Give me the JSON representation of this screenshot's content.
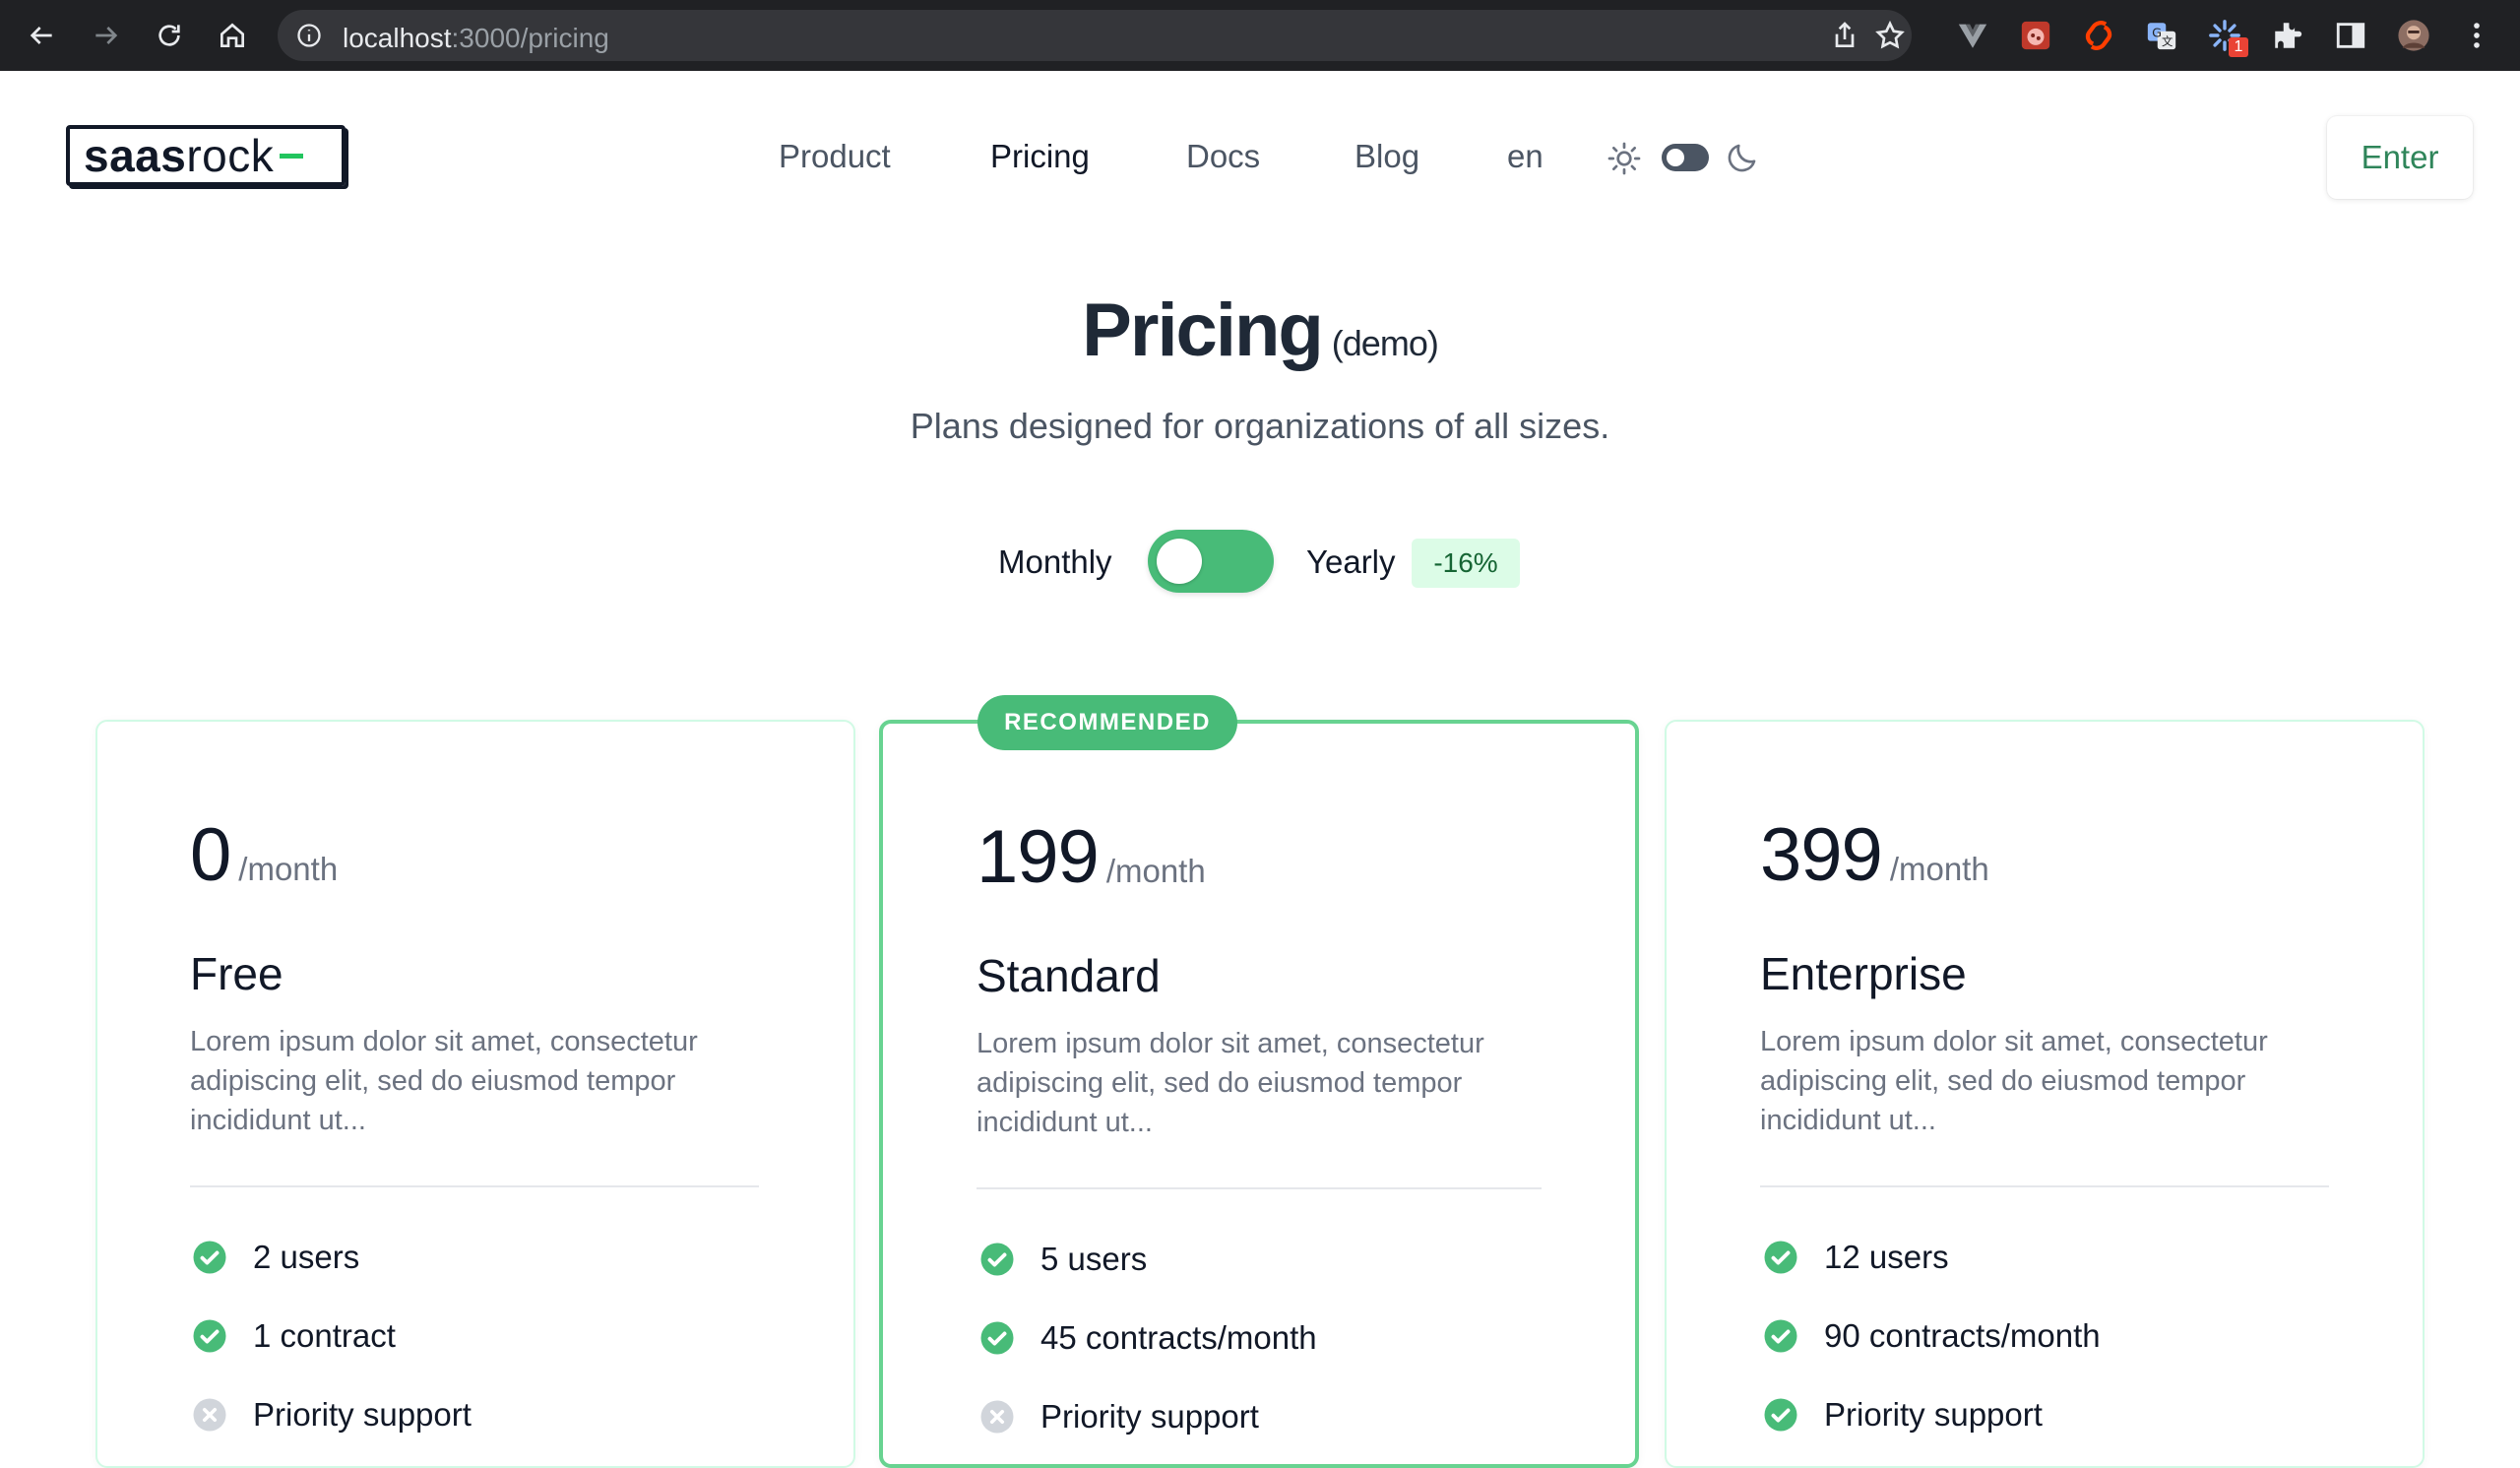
{
  "browser": {
    "url_host": "localhost",
    "url_path": ":3000/pricing",
    "extension_badge": "1",
    "icons": [
      "back-arrow-icon",
      "forward-arrow-icon",
      "reload-icon",
      "home-icon",
      "site-info-icon",
      "share-icon",
      "bookmark-star-icon",
      "vue-devtools-icon",
      "ladybug-extension-icon",
      "svelte-extension-icon",
      "translate-extension-icon",
      "loader-extension-icon",
      "puzzle-extensions-icon",
      "side-panel-icon",
      "profile-avatar-icon",
      "kebab-menu-icon"
    ]
  },
  "header": {
    "logo_bold": "saas",
    "logo_light": "rock",
    "nav": [
      {
        "label": "Product"
      },
      {
        "label": "Pricing"
      },
      {
        "label": "Docs"
      },
      {
        "label": "Blog"
      },
      {
        "label": "en"
      }
    ],
    "enter_label": "Enter"
  },
  "hero": {
    "title": "Pricing",
    "title_suffix": "(demo)",
    "subtitle": "Plans designed for organizations of all sizes."
  },
  "billing": {
    "monthly_label": "Monthly",
    "yearly_label": "Yearly",
    "discount": "-16%",
    "selected": "Monthly"
  },
  "recommended_badge": "RECOMMENDED",
  "plans": [
    {
      "price": "0",
      "period": "/month",
      "name": "Free",
      "description": "Lorem ipsum dolor sit amet, consectetur adipiscing elit, sed do eiusmod tempor incididunt ut...",
      "features": [
        {
          "text": "2 users",
          "included": true
        },
        {
          "text": "1 contract",
          "included": true
        },
        {
          "text": "Priority support",
          "included": false
        }
      ]
    },
    {
      "price": "199",
      "period": "/month",
      "name": "Standard",
      "description": "Lorem ipsum dolor sit amet, consectetur adipiscing elit, sed do eiusmod tempor incididunt ut...",
      "features": [
        {
          "text": "5 users",
          "included": true
        },
        {
          "text": "45 contracts/month",
          "included": true
        },
        {
          "text": "Priority support",
          "included": false
        }
      ]
    },
    {
      "price": "399",
      "period": "/month",
      "name": "Enterprise",
      "description": "Lorem ipsum dolor sit amet, consectetur adipiscing elit, sed do eiusmod tempor incididunt ut...",
      "features": [
        {
          "text": "12 users",
          "included": true
        },
        {
          "text": "90 contracts/month",
          "included": true
        },
        {
          "text": "Priority support",
          "included": true
        }
      ]
    }
  ],
  "colors": {
    "accent_green": "#48bb78",
    "accent_green_light": "#dcfce7",
    "excluded_gray": "#d1d5db",
    "chrome_bg": "#202124"
  }
}
